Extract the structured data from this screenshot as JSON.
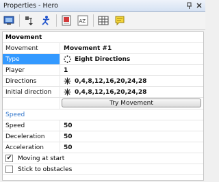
{
  "window": {
    "title": "Properties - Hero"
  },
  "toolbar": {
    "icons": [
      "display-icon",
      "actions-icon",
      "movement-icon",
      "values-icon",
      "alterable-strings-icon",
      "table-icon",
      "about-icon"
    ]
  },
  "movement_section": {
    "header": "Movement",
    "rows": [
      {
        "label": "Movement",
        "value": "Movement #1"
      },
      {
        "label": "Type",
        "value": "Eight Directions"
      },
      {
        "label": "Player",
        "value": "1"
      },
      {
        "label": "Directions",
        "value": "0,4,8,12,16,20,24,28"
      },
      {
        "label": "Initial direction",
        "value": "0,4,8,12,16,20,24,28"
      }
    ],
    "try_button": "Try Movement"
  },
  "speed_section": {
    "header": "Speed",
    "rows": [
      {
        "label": "Speed",
        "value": "50"
      },
      {
        "label": "Deceleration",
        "value": "50"
      },
      {
        "label": "Acceleration",
        "value": "50"
      }
    ]
  },
  "options": [
    {
      "label": "Moving at start",
      "checked": true,
      "mark": "✔"
    },
    {
      "label": "Stick to obstacles",
      "checked": false,
      "mark": ""
    }
  ],
  "colors": {
    "selection": "#3399ff",
    "section_blue": "#3377cc"
  }
}
